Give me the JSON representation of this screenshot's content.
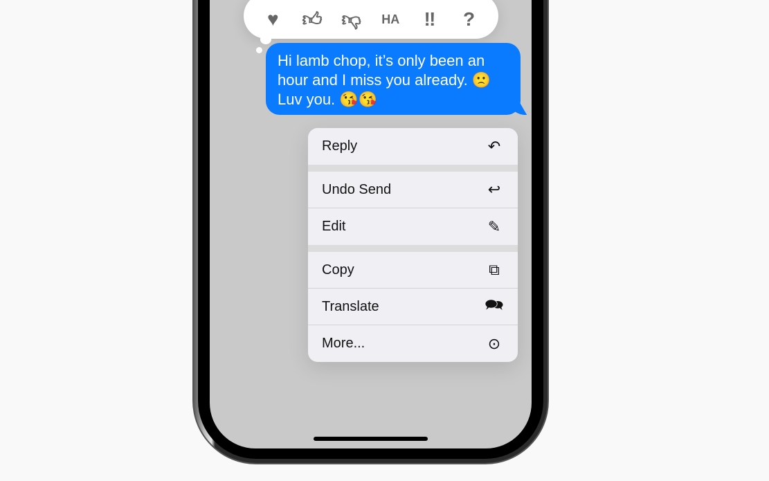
{
  "reactions": [
    {
      "icon": "heart-icon",
      "glyph": "♥"
    },
    {
      "icon": "thumbs-up-icon",
      "glyph": "👍︎"
    },
    {
      "icon": "thumbs-down-icon",
      "glyph": "👎︎"
    },
    {
      "icon": "haha-icon",
      "glyph": "HA"
    },
    {
      "icon": "exclamation-icon",
      "glyph": "‼"
    },
    {
      "icon": "question-icon",
      "glyph": "?"
    }
  ],
  "message": {
    "text": "Hi lamb chop, it’s only been an hour and I miss you already. 🙁 Luv you. 😘😘",
    "color": "#0a7aff"
  },
  "menu": {
    "reply": {
      "label": "Reply",
      "glyph": "↶"
    },
    "undo": {
      "label": "Undo Send",
      "glyph": "↩"
    },
    "edit": {
      "label": "Edit",
      "glyph": "✎"
    },
    "copy": {
      "label": "Copy",
      "glyph": "⧉"
    },
    "translate": {
      "label": "Translate",
      "glyph": "🗪"
    },
    "more": {
      "label": "More...",
      "glyph": "⊙"
    }
  }
}
